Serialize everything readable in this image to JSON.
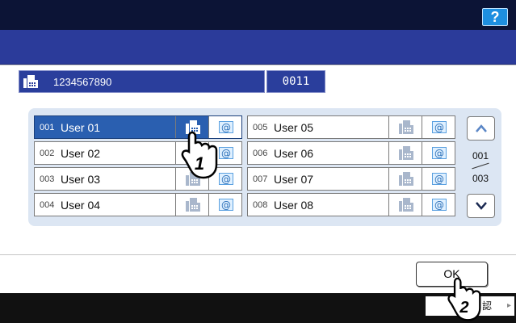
{
  "header": {
    "help_label": "?"
  },
  "destination": {
    "fax_number": "1234567890",
    "count": "0011"
  },
  "address_list": {
    "rows": [
      {
        "num": "001",
        "name": "User 01",
        "selected": true,
        "fax_on": true
      },
      {
        "num": "002",
        "name": "User 02",
        "selected": false,
        "fax_on": false
      },
      {
        "num": "003",
        "name": "User 03",
        "selected": false,
        "fax_on": false
      },
      {
        "num": "004",
        "name": "User 04",
        "selected": false,
        "fax_on": false
      },
      {
        "num": "005",
        "name": "User 05",
        "selected": false,
        "fax_on": false
      },
      {
        "num": "006",
        "name": "User 06",
        "selected": false,
        "fax_on": false
      },
      {
        "num": "007",
        "name": "User 07",
        "selected": false,
        "fax_on": false
      },
      {
        "num": "008",
        "name": "User 08",
        "selected": false,
        "fax_on": false
      }
    ],
    "page_current": "001",
    "page_total": "003"
  },
  "footer": {
    "ok_label": "OK",
    "confirm_label": "認"
  },
  "callouts": {
    "step1": "1",
    "step2": "2"
  },
  "colors": {
    "top_bar": "#0c1436",
    "blue_band": "#2b3b9a",
    "selected_row": "#2a5fb0",
    "panel": "#dce6f3",
    "help_button": "#1e8fe0"
  },
  "icons": {
    "fax": "fax-icon",
    "email": "email-icon",
    "up": "chevron-up-icon",
    "down": "chevron-down-icon",
    "pointer": "hand-pointer-icon"
  }
}
